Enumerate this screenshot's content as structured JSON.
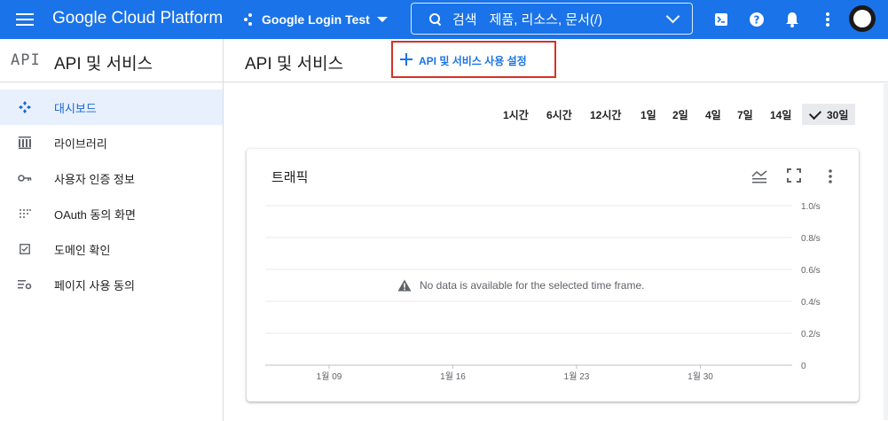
{
  "topbar": {
    "brand": "Google Cloud Platform",
    "project": "Google Login Test",
    "search_label": "검색",
    "search_placeholder": "제품, 리소스, 문서(/)",
    "icons": [
      "menu-icon",
      "project-dots-icon",
      "search-icon",
      "cloud-shell-icon",
      "help-icon",
      "notifications-icon",
      "more-vert-icon"
    ]
  },
  "sidebar": {
    "logo": "API",
    "title": "API 및 서비스",
    "items": [
      {
        "label": "대시보드",
        "icon": "dashboard-icon",
        "active": true
      },
      {
        "label": "라이브러리",
        "icon": "library-icon",
        "active": false
      },
      {
        "label": "사용자 인증 정보",
        "icon": "key-icon",
        "active": false
      },
      {
        "label": "OAuth 동의 화면",
        "icon": "oauth-dots-icon",
        "active": false
      },
      {
        "label": "도메인 확인",
        "icon": "checkbox-icon",
        "active": false
      },
      {
        "label": "페이지 사용 동의",
        "icon": "settings-list-icon",
        "active": false
      }
    ]
  },
  "main": {
    "title": "API 및 서비스",
    "enable_button": "API 및 서비스 사용 설정",
    "ranges": [
      "1시간",
      "6시간",
      "12시간",
      "1일",
      "2일",
      "4일",
      "7일",
      "14일",
      "30일"
    ],
    "selected_range": "30일"
  },
  "card": {
    "title": "트래픽",
    "no_data": "No data is available for the selected time frame."
  },
  "chart_data": {
    "type": "line",
    "title": "트래픽",
    "x_ticks": [
      "1월 09",
      "1월 16",
      "1월 23",
      "1월 30"
    ],
    "y_ticks": [
      "1.0/s",
      "0.8/s",
      "0.6/s",
      "0.4/s",
      "0.2/s",
      "0"
    ],
    "ylim": [
      0,
      1.0
    ],
    "grid": true,
    "series": []
  },
  "colors": {
    "topbar": "#1a73e8",
    "active_bg": "#e8f0fe",
    "active_text": "#1967d2",
    "highlight_border": "#d93025"
  }
}
